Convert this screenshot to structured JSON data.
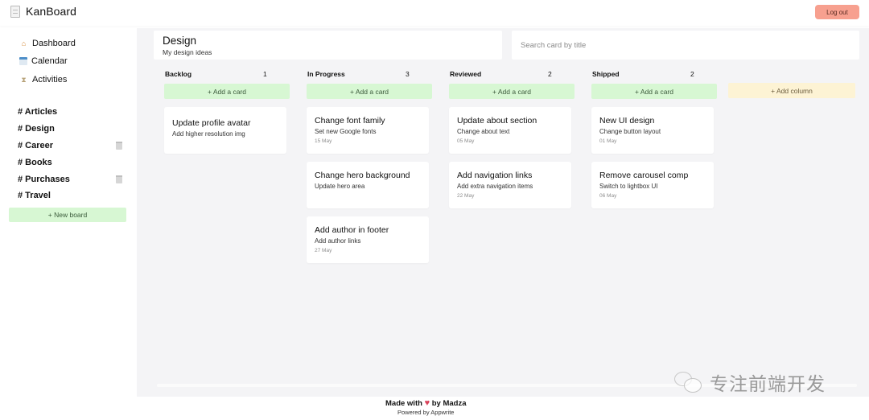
{
  "app": {
    "name": "KanBoard",
    "logout_label": "Log out"
  },
  "sidebar": {
    "nav": [
      {
        "icon": "house-icon",
        "glyph": "🏠",
        "label": "Dashboard"
      },
      {
        "icon": "calendar-icon",
        "glyph": "",
        "label": "Calendar"
      },
      {
        "icon": "hourglass-icon",
        "glyph": "⏳",
        "label": "Activities"
      }
    ],
    "boards": [
      {
        "label": "# Articles",
        "deletable": false
      },
      {
        "label": "# Design",
        "deletable": false
      },
      {
        "label": "# Career",
        "deletable": true
      },
      {
        "label": "# Books",
        "deletable": false
      },
      {
        "label": "# Purchases",
        "deletable": true
      },
      {
        "label": "# Travel",
        "deletable": false
      }
    ],
    "new_board_label": "+ New board"
  },
  "board": {
    "title": "Design",
    "description": "My design ideas",
    "search_placeholder": "Search card by title",
    "search_value": "",
    "add_card_label": "+ Add a card",
    "add_column_label": "+ Add column",
    "columns": [
      {
        "title": "Backlog",
        "count": "1",
        "cards": [
          {
            "title": "Update profile avatar",
            "description": "Add higher resolution img",
            "date": ""
          }
        ]
      },
      {
        "title": "In Progress",
        "count": "3",
        "cards": [
          {
            "title": "Change font family",
            "description": "Set new Google fonts",
            "date": "15 May"
          },
          {
            "title": "Change hero background",
            "description": "Update hero area",
            "date": ""
          },
          {
            "title": "Add author in footer",
            "description": "Add author links",
            "date": "27 May"
          }
        ]
      },
      {
        "title": "Reviewed",
        "count": "2",
        "cards": [
          {
            "title": "Update about section",
            "description": "Change about text",
            "date": "05 May"
          },
          {
            "title": "Add navigation links",
            "description": "Add extra navigation items",
            "date": "22 May"
          }
        ]
      },
      {
        "title": "Shipped",
        "count": "2",
        "cards": [
          {
            "title": "New UI design",
            "description": "Change button layout",
            "date": "01 May"
          },
          {
            "title": "Remove carousel comp",
            "description": "Switch to lightbox UI",
            "date": "06 May"
          }
        ]
      }
    ]
  },
  "footer": {
    "made_with": "Made with",
    "heart": "♥",
    "by": "by Madza",
    "powered_by": "Powered by Appwrite"
  },
  "watermark": {
    "text": "专注前端开发"
  },
  "colors": {
    "logout_bg": "#f7a08f",
    "add_card_bg": "#d7f7d3",
    "add_column_bg": "#fdf3d4",
    "main_bg": "#f4f4f6",
    "heart": "#d9435a"
  }
}
